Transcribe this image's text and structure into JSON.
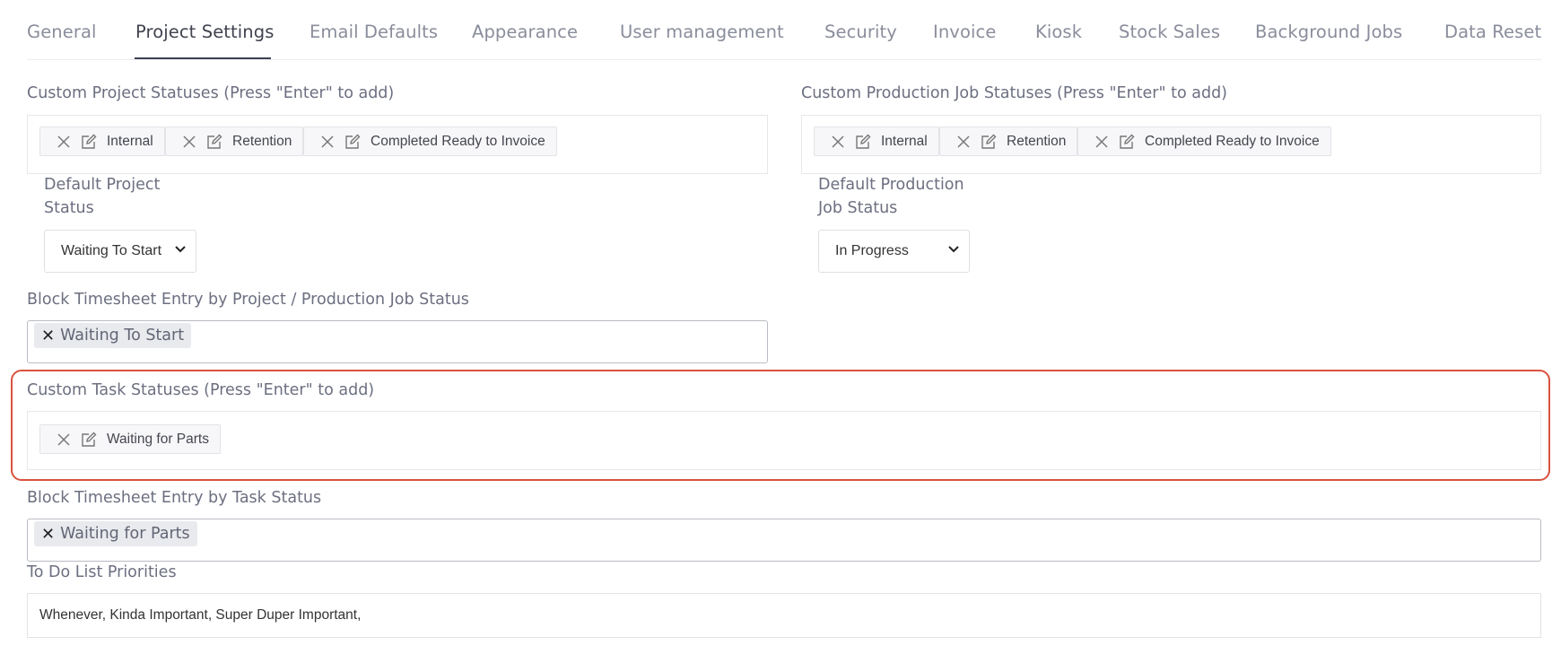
{
  "tabs": [
    {
      "label": "General",
      "active": false
    },
    {
      "label": "Project Settings",
      "active": true
    },
    {
      "label": "Email Defaults",
      "active": false
    },
    {
      "label": "Appearance",
      "active": false
    },
    {
      "label": "User management",
      "active": false
    },
    {
      "label": "Security",
      "active": false
    },
    {
      "label": "Invoice",
      "active": false
    },
    {
      "label": "Kiosk",
      "active": false
    },
    {
      "label": "Stock Sales",
      "active": false
    },
    {
      "label": "Background Jobs",
      "active": false
    },
    {
      "label": "Data Reset",
      "active": false
    }
  ],
  "project_statuses": {
    "label": "Custom Project Statuses (Press \"Enter\" to add)",
    "tags": [
      "Internal",
      "Retention",
      "Completed Ready to Invoice"
    ]
  },
  "production_statuses": {
    "label": "Custom Production Job Statuses (Press \"Enter\" to add)",
    "tags": [
      "Internal",
      "Retention",
      "Completed Ready to Invoice"
    ]
  },
  "default_project_status": {
    "label_line1": "Default Project",
    "label_line2": "Status",
    "value": "Waiting To Start"
  },
  "default_production_status": {
    "label_line1": "Default Production",
    "label_line2": "Job Status",
    "value": "In Progress"
  },
  "block_by_project": {
    "label": "Block Timesheet Entry by Project / Production Job Status",
    "chips": [
      "Waiting To Start"
    ]
  },
  "task_statuses": {
    "label": "Custom Task Statuses (Press \"Enter\" to add)",
    "tags": [
      "Waiting for Parts"
    ]
  },
  "block_by_task": {
    "label": "Block Timesheet Entry by Task Status",
    "chips": [
      "Waiting for Parts"
    ]
  },
  "todo_priorities": {
    "label": "To Do List Priorities",
    "value": "Whenever, Kinda Important, Super Duper Important,"
  },
  "colors": {
    "highlight": "#d9513e",
    "active_tab": "#40434f"
  }
}
